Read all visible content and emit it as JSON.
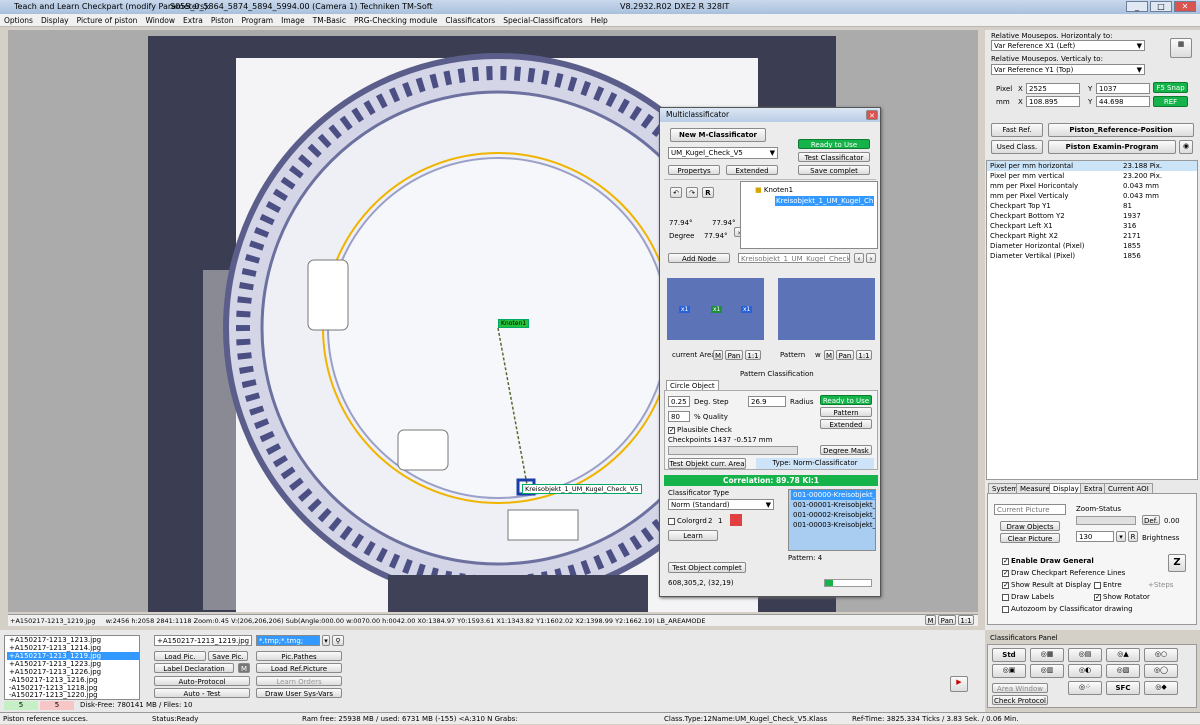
{
  "window": {
    "title": "Teach and Learn Checkpart (modify Parameters):",
    "file": "S055_0_5864_5874_5894_5994.00  (Camera 1)",
    "company": "Techniken TM-Soft",
    "version": "V8.2932.R02 DXE2 R 328IT",
    "min": "_",
    "max": "□",
    "close": "✕"
  },
  "menu": [
    "Options",
    "Display",
    "Picture of piston",
    "Window",
    "Extra",
    "Piston",
    "Program",
    "Image",
    "TM-Basic",
    "PRG-Checking module",
    "Classificators",
    "Special-Classificators",
    "Help"
  ],
  "overlay": {
    "node_label": "Knoten1",
    "object_label": "Kreisobjekt_1_UM_Kugel_Check_V5"
  },
  "image_status": {
    "file": "+A150217-1213_1219.jpg",
    "text": "w:2456  h:2058    2841:1118   Zoom:0.45   V:(206,206,206)   Sub(Angle:000.00   w:0070.00   h:0042.00   X0:1384.97   Y0:1593.61   X1:1343.82   Y1:1602.02   X2:1398.99   Y2:1662.19)      LB_AREAMODE",
    "m": "M",
    "pan": "Pan",
    "one": "1:1"
  },
  "multi": {
    "title": "Multiclassificator",
    "new_btn": "New M-Classificator",
    "ready": "Ready to Use",
    "test_cls": "Test Classificator",
    "save": "Save complet",
    "combo": "UM_Kugel_Check_V5",
    "properties": "Propertys",
    "extended": "Extended",
    "undo": "↶",
    "redo": "↷",
    "r": "R",
    "angle1": "77.94°",
    "angle2": "77.94°",
    "degree_label": "Degree",
    "degree_val": "77.94°",
    "tree_root": "Knoten1",
    "tree_child": "Kreisobjekt_1_UM_Kugel_Ch",
    "add_node": "Add Node",
    "node_combo": "Kreisobjekt_1_UM_Kugel_Check",
    "current_area": "current Area",
    "pattern_lbl": "Pattern",
    "w": "w",
    "m": "M",
    "pan": "Pan",
    "one": "1:1",
    "pattern_class": "Pattern Classification",
    "circle_tab": "Circle Object",
    "v1": "0.25",
    "deg_step": "Deg. Step",
    "v2": "26.9",
    "radius": "Radius",
    "v3": "80",
    "quality": "% Quality",
    "ready2": "Ready to Use",
    "pattern_btn": "Pattern",
    "extended2": "Extended",
    "plausible": "Plausible Check",
    "checkpoints": "Checkpoints 1437",
    "mm": "-0.517 mm",
    "degree_mask": "Degree Mask",
    "test_obj": "Test Objekt curr. Area",
    "type": "Type: Norm-Classificator",
    "correlation": "Correlation: 89.78 Kl:1",
    "cls_type": "Classificator Type",
    "norm": "Norm (Standard)",
    "colorgrd": "Colorgrd",
    "two": "2",
    "one2": "1",
    "learn": "Learn",
    "list": [
      "001-00000-Kreisobjekt_1_UI",
      "001-00001-Kreisobjekt_1_UI",
      "001-00002-Kreisobjekt_1_UI",
      "001-00003-Kreisobjekt_1_UI"
    ],
    "pattern_count": "Pattern: 4",
    "test_complete": "Test Object complet",
    "coords": "608,305,2, (32,19)",
    "chip1": "x1",
    "chip2": "x1",
    "chip3": "x1"
  },
  "right": {
    "rel_h": "Relative Mousepos. Horizontaly to:",
    "rel_h_val": "Var Reference X1 (Left)",
    "rel_v": "Relative Mousepos. Verticaly to:",
    "rel_v_val": "Var Reference Y1 (Top)",
    "pixel": "Pixel",
    "x": "X",
    "y": "Y",
    "px": "2525",
    "py": "1037",
    "mm": "mm",
    "mx": "108.895",
    "my": "44.698",
    "f5": "F5 Snap",
    "ref": "REF",
    "fast_ref": "Fast Ref.",
    "piston_ref": "Piston_Reference-Position",
    "used": "Used Class.",
    "piston_exam": "Piston Examin-Program",
    "props": [
      [
        "Pixel per mm horizontal",
        "23.188 Pix."
      ],
      [
        "Pixel per mm vertical",
        "23.200 Pix."
      ],
      [
        "mm per Pixel Horicontaly",
        "0.043 mm"
      ],
      [
        "mm per Pixel Verticaly",
        "0.043 mm"
      ],
      [
        "Checkpart Top Y1",
        "81"
      ],
      [
        "Checkpart Bottom Y2",
        "1937"
      ],
      [
        "Checkpart Left X1",
        "316"
      ],
      [
        "Checkpart Right X2",
        "2171"
      ],
      [
        "Diameter Horizontal (Pixel)",
        "1855"
      ],
      [
        "Diameter Vertikal (Pixel)",
        "1856"
      ]
    ],
    "tabs": [
      "System",
      "Measure",
      "Display",
      "Extra",
      "Current AOI"
    ],
    "current_picture": "Current Picture",
    "draw_objects": "Draw Objects",
    "clear_picture": "Clear Picture",
    "zoom_status": "Zoom-Status",
    "def": "Def.",
    "zoom_val": "0.00",
    "bright_val": "130",
    "brightness": "Brightness",
    "r": "R",
    "enable_draw": "Enable Draw General",
    "draw_ref": "Draw Checkpart Reference Lines",
    "show_result": "Show Result at Display",
    "entre": "Entre",
    "steps": "+Steps",
    "draw_labels": "Draw Labels",
    "show_rotator": "Show Rotator",
    "autozoom": "Autozoom by Classificator drawing",
    "z": "Z",
    "cls_panel": "Classificators Panel",
    "std": "Std",
    "sfc": "SFC",
    "area_window": "Area Window",
    "check_protocol": "Check Protocol"
  },
  "bottom": {
    "files": [
      "+A150217-1213_1213.jpg",
      "+A150217-1213_1214.jpg",
      "+A150217-1213_1219.jpg",
      "+A150217-1213_1223.jpg",
      "+A150217-1213_1226.jpg",
      "-A150217-1213_1216.jpg",
      "-A150217-1213_1218.jpg",
      "-A150217-1213_1220.jpg"
    ],
    "count1": "5",
    "count2": "5",
    "disk": "Disk-Free: 780141 MB / Files: 10",
    "combo": "+A150217-1213_1219.jpg",
    "filter": "*.tmp;*.tmg;",
    "load_pic": "Load Pic.",
    "save_pic": "Save Pic.",
    "pic_pathes": "Pic.Pathes",
    "label_decl": "Label Declaration",
    "m": "M",
    "load_ref": "Load Ref.Picture",
    "auto_protocol": "Auto-Protocol",
    "learn_orders": "Learn Orders",
    "auto_test": "Auto - Test",
    "draw_user": "Draw User Sys-Vars"
  },
  "statusbar": [
    "Piston reference succes.",
    "Status:Ready",
    "Ram free: 25938 MB / used: 6731 MB (-155) <A:310 N Grabs:",
    "Class.Type:12",
    "Name:UM_Kugel_Check_V5.Klass",
    "Ref-Time: 3825.334 Ticks / 3.83 Sek. / 0.06 Min."
  ],
  "colors": {
    "accent": "#16b34a",
    "selection": "#3399ff",
    "canvas": "#ababab"
  }
}
